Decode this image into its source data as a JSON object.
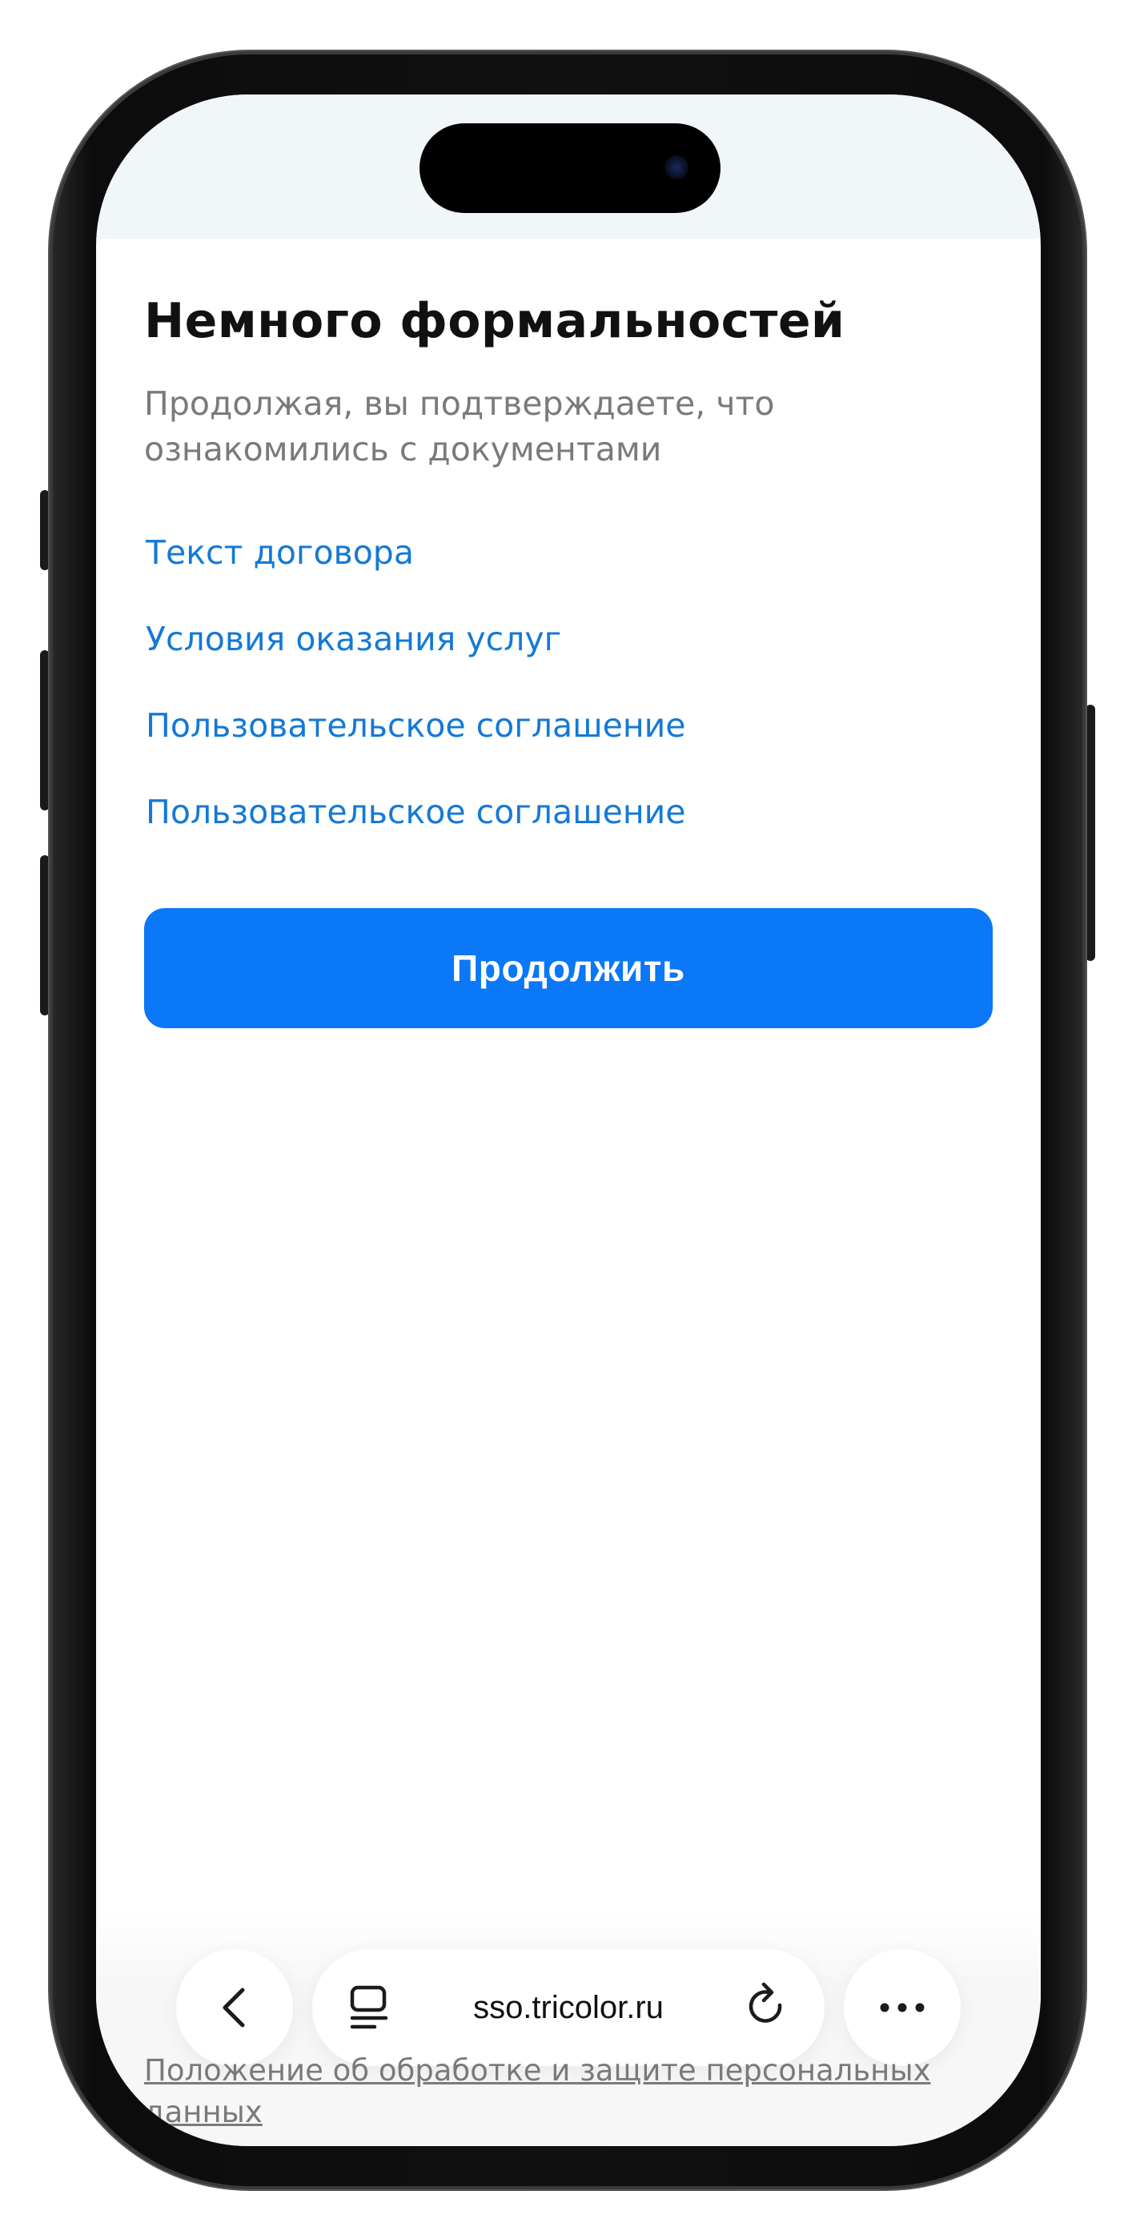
{
  "page": {
    "title": "Немного формальностей",
    "lead": "Продолжая, вы подтверждаете, что ознакомились с документами",
    "links": [
      {
        "label": "Текст договора"
      },
      {
        "label": "Условия оказания услуг"
      },
      {
        "label": "Пользовательское соглашение"
      },
      {
        "label": "Пользовательское соглашение"
      }
    ],
    "continue_label": "Продолжить",
    "footer_link": "Положение об обработке и защите персональных данных"
  },
  "browser": {
    "url": "sso.tricolor.ru",
    "icons": {
      "back": "chevron-left-icon",
      "tabs": "tabs-icon",
      "reload": "reload-icon",
      "more": "more-icon"
    }
  },
  "colors": {
    "accent": "#0a78f7",
    "link": "#1479d6",
    "muted_text": "#7a7a7a",
    "status_bg": "#f1f6f8"
  }
}
